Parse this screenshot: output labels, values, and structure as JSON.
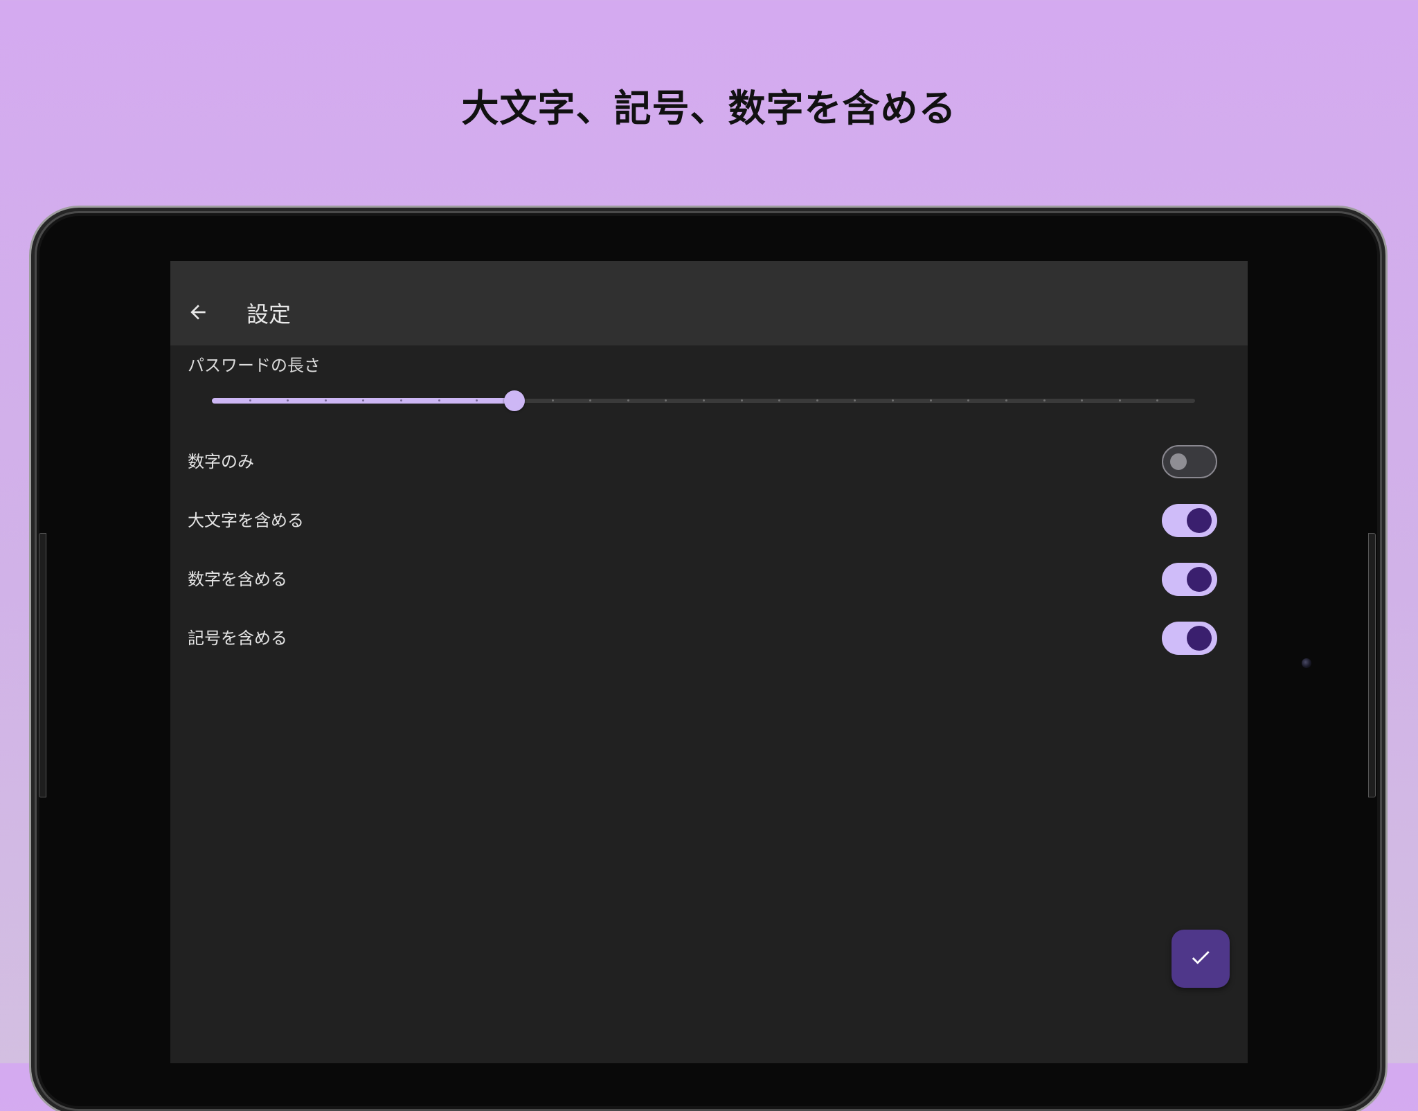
{
  "banner": {
    "headline": "大文字、記号、数字を含める"
  },
  "appbar": {
    "title": "設定",
    "back_icon": "arrow-back-icon"
  },
  "password_length": {
    "label": "パスワードの長さ",
    "slider": {
      "steps": 26,
      "value_fraction": 0.308,
      "active_color": "#cdb7f5"
    }
  },
  "settings": [
    {
      "label": "数字のみ",
      "enabled": false
    },
    {
      "label": "大文字を含める",
      "enabled": true
    },
    {
      "label": "数字を含める",
      "enabled": true
    },
    {
      "label": "記号を含める",
      "enabled": true
    }
  ],
  "fab": {
    "icon": "check-icon",
    "color": "#4f378a"
  },
  "theme": {
    "switch_on_track": "#cfbcf9",
    "switch_on_knob": "#3a1f6e",
    "background": "#212121",
    "appbar": "#303030"
  }
}
